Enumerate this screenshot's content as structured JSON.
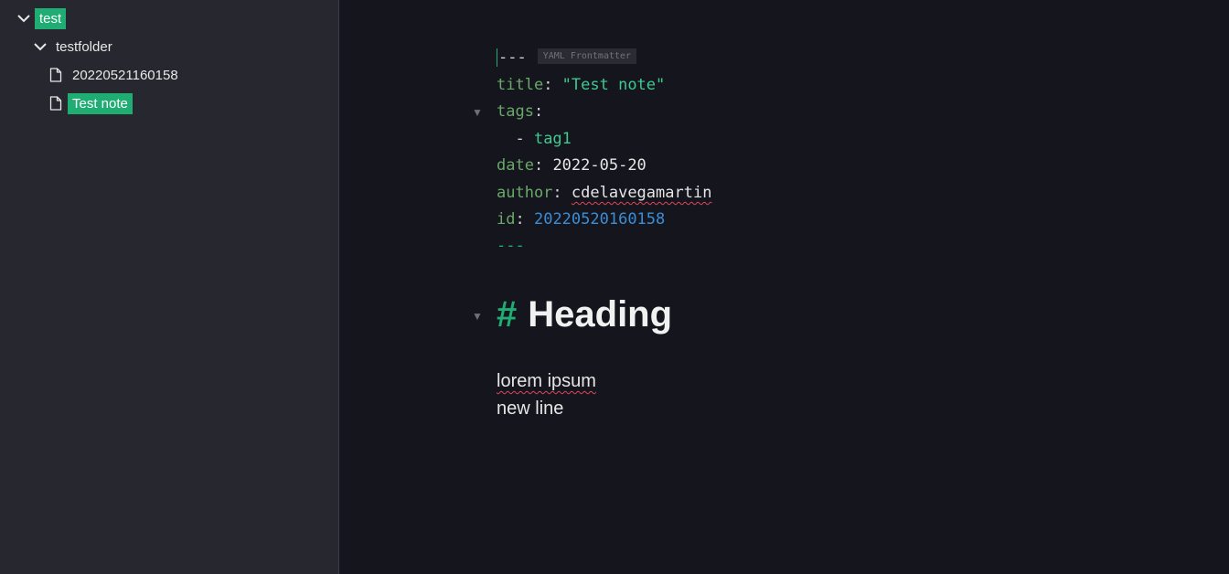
{
  "sidebar": {
    "root": {
      "label": "test",
      "expanded": true
    },
    "folder": {
      "label": "testfolder",
      "expanded": true
    },
    "files": [
      {
        "label": "20220521160158",
        "selected": false
      },
      {
        "label": "Test note",
        "selected": true
      }
    ]
  },
  "editor": {
    "frontmatter": {
      "open_delim": "---",
      "badge": "YAML Frontmatter",
      "title_key": "title",
      "title_value": "\"Test note\"",
      "tags_key": "tags",
      "tag_item": "tag1",
      "date_key": "date",
      "date_value": "2022-05-20",
      "author_key": "author",
      "author_value": "cdelavegamartin",
      "id_key": "id",
      "id_value": "20220520160158",
      "close_delim": "---"
    },
    "heading": {
      "marker": "#",
      "text": "Heading"
    },
    "body": [
      "lorem ipsum",
      "new line"
    ],
    "colors": {
      "accent": "#1fad74",
      "key": "#6aa86a",
      "number": "#3a8ed8",
      "spellcheck": "#e0455a"
    }
  }
}
